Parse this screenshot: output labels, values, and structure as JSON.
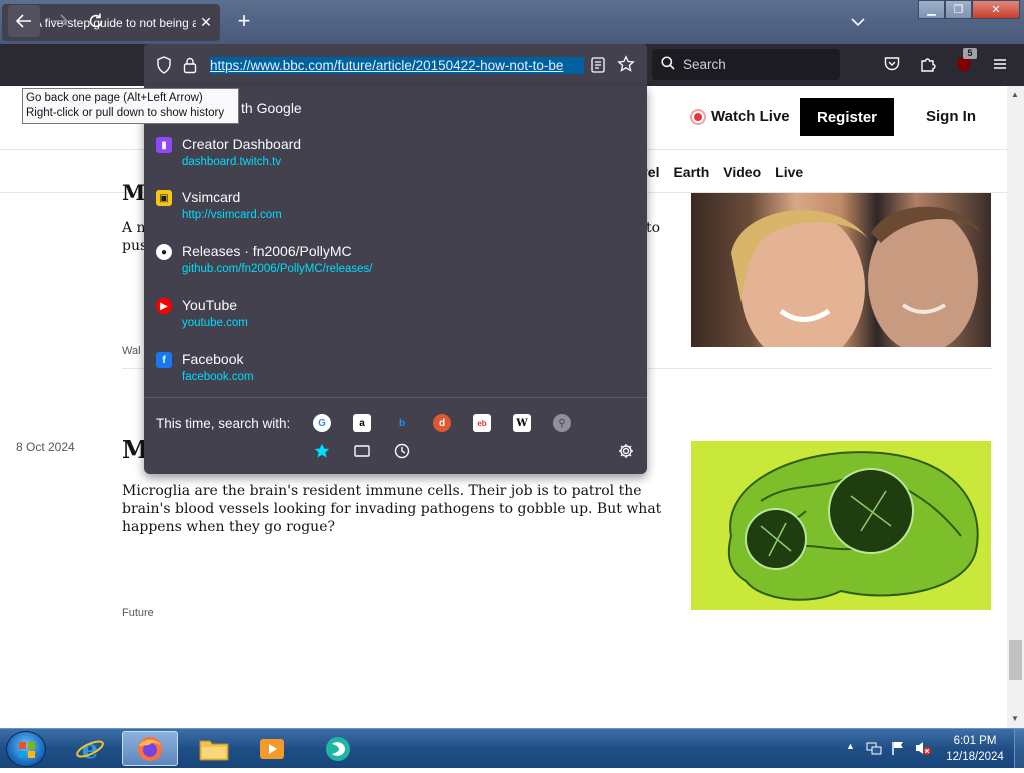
{
  "tab": {
    "title": "A five-step guide to not being a",
    "close": "✕"
  },
  "newtab": "+",
  "urlbar": {
    "url": "https://www.bbc.com/future/article/20150422-how-not-to-be"
  },
  "searchbox": {
    "placeholder": "Search"
  },
  "ext_badge": "5",
  "tooltip": {
    "line1": "Go back one page (Alt+Left Arrow)",
    "line2": "Right-click or pull down to show history"
  },
  "page": {
    "watch_live": "Watch Live",
    "register": "Register",
    "sign_in": "Sign In",
    "nav": [
      "vel",
      "Earth",
      "Video",
      "Live"
    ],
    "article1": {
      "heading": "M",
      "line1_start": "A n",
      "line1_end": "to",
      "line2": "pus",
      "source": "Wal"
    },
    "article2": {
      "date": "8 Oct 2024",
      "heading": "M",
      "summary": "Microglia are the brain's resident immune cells. Their job is to patrol the brain's blood vessels looking for invading pathogens to gobble up. But what happens when they go rogue?",
      "source": "Future"
    }
  },
  "dropdown": {
    "partial_top": "th Google",
    "suggestions": [
      {
        "title": "Creator Dashboard",
        "url": "dashboard.twitch.tv",
        "icon": "twitch-icon",
        "color": "#9146ff"
      },
      {
        "title": "Vsimcard",
        "url": "http://vsimcard.com",
        "icon": "vsimcard-icon",
        "color": "#f5c518"
      },
      {
        "title": "Releases · fn2006/PollyMC",
        "url": "github.com/fn2006/PollyMC/releases/",
        "icon": "github-icon",
        "color": "#ffffff"
      },
      {
        "title": "YouTube",
        "url": "youtube.com",
        "icon": "youtube-icon",
        "color": "#ff0000"
      },
      {
        "title": "Facebook",
        "url": "facebook.com",
        "icon": "facebook-icon",
        "color": "#1877f2"
      }
    ],
    "search_with_label": "This time, search with:",
    "engines": [
      "google-icon",
      "amazon-icon",
      "bing-icon",
      "duckduckgo-icon",
      "ebay-icon",
      "wikipedia-icon",
      "search-engine-icon"
    ]
  },
  "taskbar": {
    "time": "6:01 PM",
    "date": "12/18/2024"
  }
}
